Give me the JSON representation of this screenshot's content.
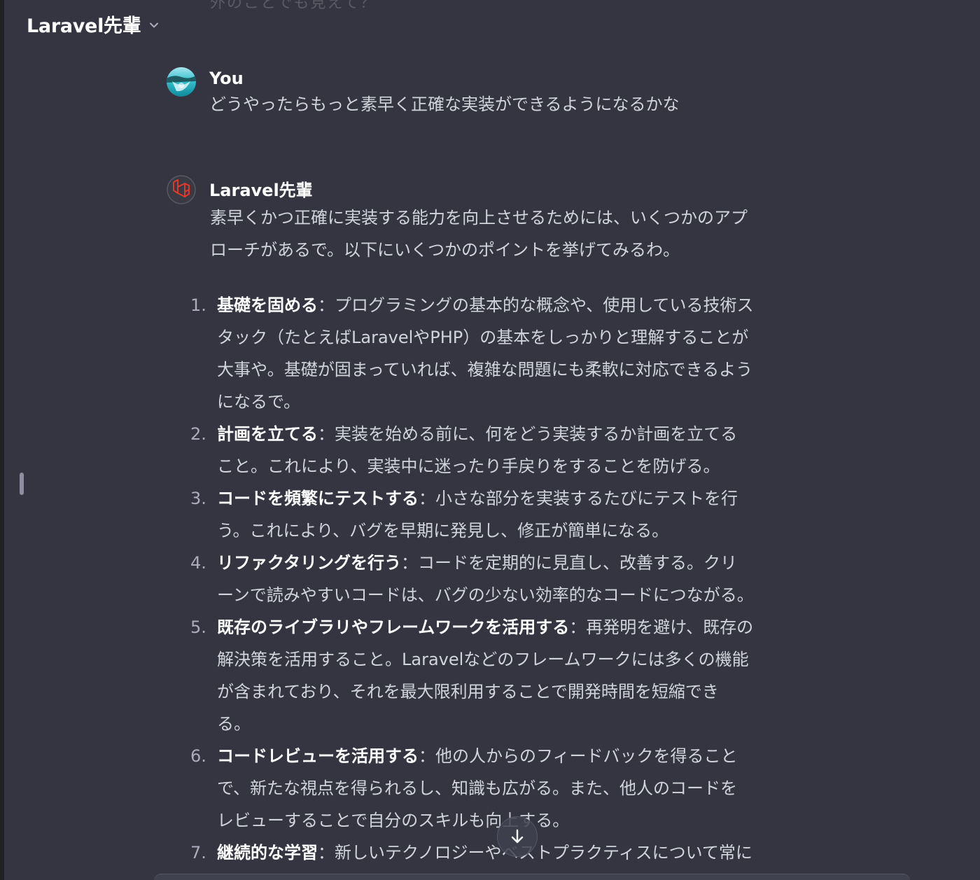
{
  "header": {
    "title": "Laravel先輩",
    "partial_previous_text": "外のことでも見えて？"
  },
  "user_message": {
    "author": "You",
    "text": "どうやったらもっと素早く正確な実装ができるようになるかな"
  },
  "assistant_message": {
    "author": "Laravel先輩",
    "intro_lines": [
      "素早くかつ正確に実装する能力を向上させるためには、いくつかのアプ",
      "ローチがあるで。以下にいくつかのポイントを挙げてみるわ。"
    ],
    "points": [
      {
        "number": "1.",
        "title": "基礎を固める",
        "lines": [
          "：プログラミングの基本的な概念や、使用している技術ス",
          "タック（たとえばLaravelやPHP）の基本をしっかりと理解することが",
          "大事や。基礎が固まっていれば、複雑な問題にも柔軟に対応できるよう",
          "になるで。"
        ]
      },
      {
        "number": "2.",
        "title": "計画を立てる",
        "lines": [
          "：実装を始める前に、何をどう実装するか計画を立てる",
          "こと。これにより、実装中に迷ったり手戻りをすることを防げる。"
        ]
      },
      {
        "number": "3.",
        "title": "コードを頻繁にテストする",
        "lines": [
          "：小さな部分を実装するたびにテストを行",
          "う。これにより、バグを早期に発見し、修正が簡単になる。"
        ]
      },
      {
        "number": "4.",
        "title": "リファクタリングを行う",
        "lines": [
          "：コードを定期的に見直し、改善する。クリ",
          "ーンで読みやすいコードは、バグの少ない効率的なコードにつながる。"
        ]
      },
      {
        "number": "5.",
        "title": "既存のライブラリやフレームワークを活用する",
        "lines": [
          "：再発明を避け、既存の",
          "解決策を活用すること。Laravelなどのフレームワークには多くの機能",
          "が含まれており、それを最大限利用することで開発時間を短縮でき",
          "る。"
        ]
      },
      {
        "number": "6.",
        "title": "コードレビューを活用する",
        "lines": [
          "：他の人からのフィードバックを得ること",
          "で、新たな視点を得られるし、知識も広がる。また、他人のコードを",
          "レビューすることで自分のスキルも向上する。"
        ]
      },
      {
        "number": "7.",
        "title": "継続的な学習",
        "lines": [
          "：新しいテクノロジーやベストプラクティスについて常に"
        ]
      }
    ]
  },
  "icons": {
    "header_chevron": "chevron-down-icon",
    "scroll_down": "arrow-down-icon",
    "user_avatar": "user-avatar",
    "assistant_avatar": "laravel-logo-avatar"
  },
  "colors": {
    "background": "#343541",
    "laravel_red": "#e0392b",
    "user_avatar_teal": "#2ec4c4"
  }
}
